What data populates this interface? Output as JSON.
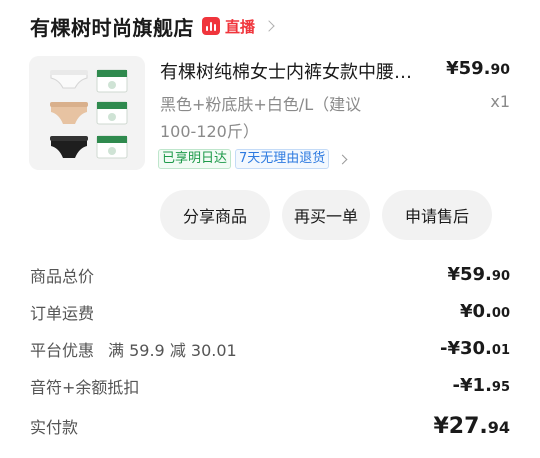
{
  "store": {
    "name": "有棵树时尚旗舰店",
    "live_label": "直播"
  },
  "product": {
    "title": "有棵树纯棉女士内裤女款中腰抗菌透气",
    "variant": "黑色+粉底肤+白色/L（建议100-120斤）",
    "price_int": "¥59.",
    "price_dec": "90",
    "quantity": "x1",
    "tags": [
      "已享明日达",
      "7天无理由退货"
    ]
  },
  "actions": {
    "share": "分享商品",
    "rebuy": "再买一单",
    "after_sale": "申请售后"
  },
  "summary": {
    "goods_total": {
      "label": "商品总价",
      "int": "¥59.",
      "dec": "90"
    },
    "shipping": {
      "label": "订单运费",
      "int": "¥0.",
      "dec": "00"
    },
    "platform": {
      "label": "平台优惠",
      "extra": "满 59.9 减 30.01",
      "int": "-¥30.",
      "dec": "01"
    },
    "balance": {
      "label": "音符+余额抵扣",
      "int": "-¥1.",
      "dec": "95"
    },
    "paid": {
      "label": "实付款",
      "int": "¥27.",
      "dec": "94"
    }
  },
  "colors": {
    "accent_red": "#f0353c",
    "tag_green": "#1e9a4a",
    "tag_blue": "#2d7ae0"
  }
}
